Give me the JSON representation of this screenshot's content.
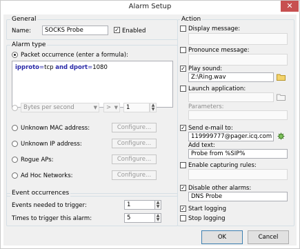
{
  "window": {
    "title": "Alarm Setup",
    "close_glyph": "✕"
  },
  "general": {
    "legend": "General",
    "name_label": "Name:",
    "name_value": "SOCKS Probe",
    "enabled_label": "Enabled",
    "enabled_checked": true
  },
  "alarm_type": {
    "legend": "Alarm type",
    "packet_occurrence_label": "Packet occurrence (enter a formula):",
    "formula": {
      "kw1": "ipproto",
      "op1": "=",
      "val1": "tcp",
      "and": "and",
      "kw2": "dport",
      "op2": "=",
      "val2": "1080"
    },
    "bytes_per_second": {
      "unit": "Bytes per second",
      "operator": ">",
      "value": "1"
    },
    "unknown_mac_label": "Unknown MAC address:",
    "unknown_ip_label": "Unknown IP address:",
    "rogue_aps_label": "Rogue APs:",
    "adhoc_label": "Ad Hoc Networks:",
    "configure_label": "Configure..."
  },
  "event_occurrences": {
    "legend": "Event occurrences",
    "events_needed_label": "Events needed to trigger:",
    "events_needed_value": "1",
    "times_label": "Times to trigger this alarm:",
    "times_value": "5"
  },
  "action": {
    "legend": "Action",
    "display_message_label": "Display message:",
    "pronounce_message_label": "Pronounce message:",
    "play_sound_label": "Play sound:",
    "play_sound_value": "Z:\\Ring.wav",
    "launch_app_label": "Launch application:",
    "parameters_label": "Parameters:",
    "send_email_label": "Send e-mail to:",
    "email_value": "119999777@pager.icq.com",
    "add_text_label": "Add text:",
    "add_text_value": "Probe from %SIP%",
    "enable_capturing_label": "Enable capturing rules:",
    "disable_alarms_label": "Disable other alarms:",
    "disable_alarms_value": "DNS Probe",
    "start_logging_label": "Start logging",
    "stop_logging_label": "Stop logging"
  },
  "buttons": {
    "ok": "OK",
    "cancel": "Cancel"
  },
  "colors": {
    "formula_keyword": "#2a2aa8",
    "close_button": "#c75050",
    "default_button_border": "#3c7fb1"
  }
}
